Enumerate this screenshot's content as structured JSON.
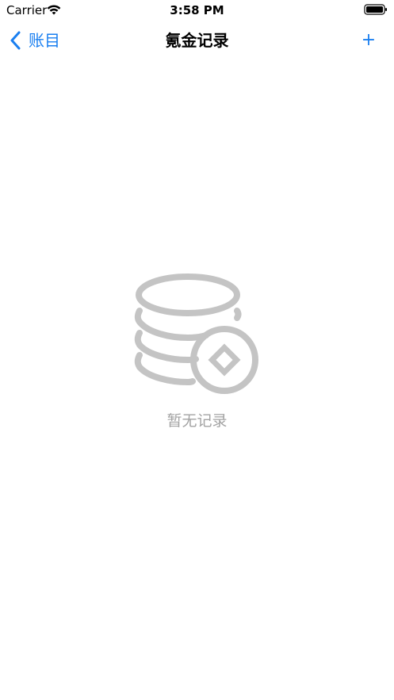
{
  "status_bar": {
    "carrier": "Carrier",
    "time": "3:58 PM",
    "wifi_icon": "wifi-icon",
    "battery_icon": "battery-icon"
  },
  "nav": {
    "back_label": "账目",
    "title": "氪金记录",
    "add_label": "+",
    "accent_color": "#1a7ff0"
  },
  "empty_state": {
    "icon": "coins-icon",
    "message": "暂无记录",
    "icon_color": "#c4c4c4",
    "text_color": "#a3a3a3"
  }
}
